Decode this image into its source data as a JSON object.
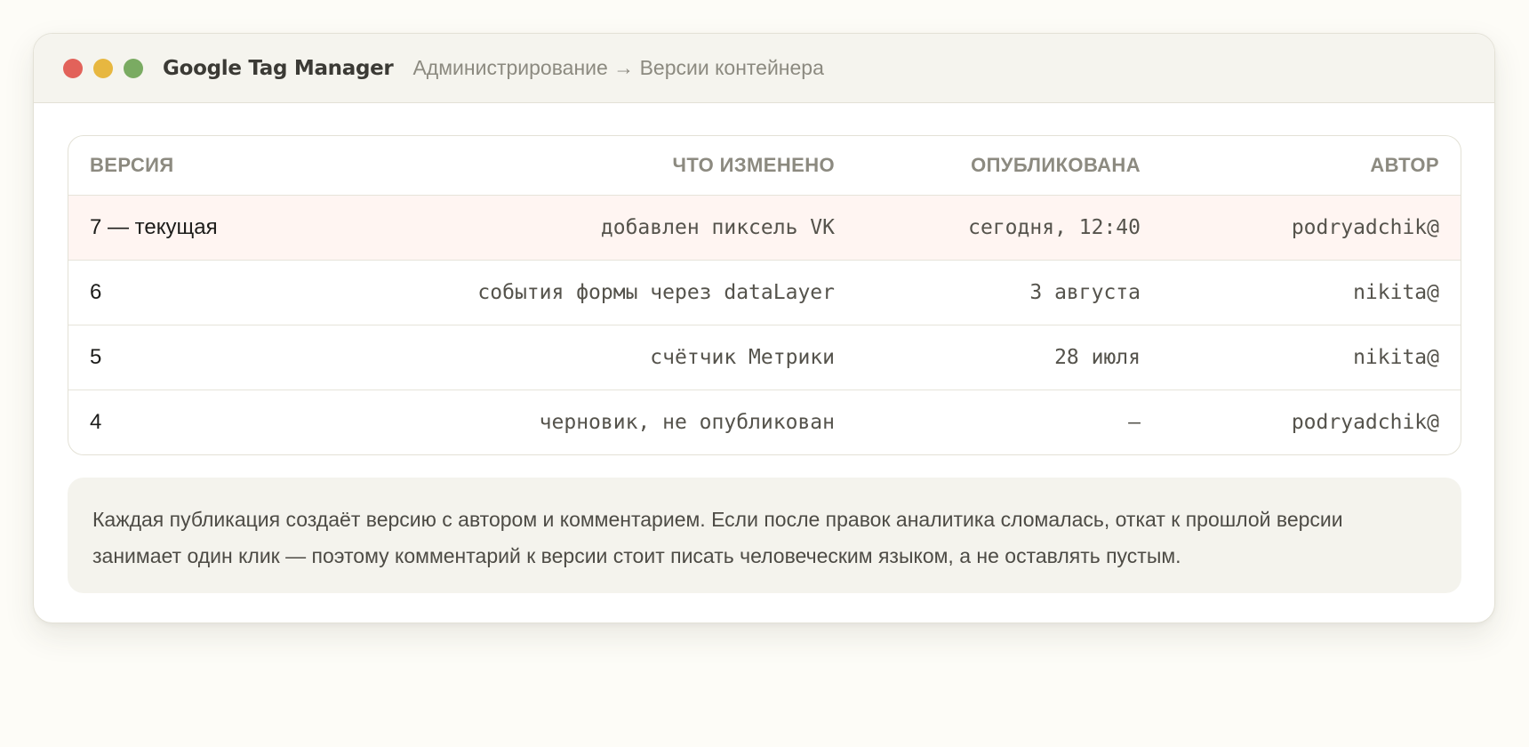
{
  "window": {
    "app_title": "Google Tag Manager",
    "breadcrumb": "Администрирование → Версии контейнера"
  },
  "table": {
    "headers": [
      "ВЕРСИЯ",
      "ЧТО ИЗМЕНЕНО",
      "ОПУБЛИКОВАНА",
      "АВТОР"
    ],
    "rows": [
      {
        "version": "7 — текущая",
        "changes": "добавлен пиксель VK",
        "published": "сегодня, 12:40",
        "author": "podryadchik@",
        "current": true
      },
      {
        "version": "6",
        "changes": "события формы через dataLayer",
        "published": "3 августа",
        "author": "nikita@"
      },
      {
        "version": "5",
        "changes": "счётчик Метрики",
        "published": "28 июля",
        "author": "nikita@"
      },
      {
        "version": "4",
        "changes": "черновик, не опубликован",
        "published": "—",
        "author": "podryadchik@"
      }
    ]
  },
  "note": {
    "text": "Каждая публикация создаёт версию с автором и комментарием. Если после правок аналитика сломалась, откат к прошлой версии занимает один клик — поэтому комментарий к версии стоит писать человеческим языком, а не оставлять пустым."
  },
  "colors": {
    "close": "#e2625a",
    "minimize": "#e7b740",
    "maximize": "#7aab62",
    "current_row_bg": "#fff5f2"
  }
}
